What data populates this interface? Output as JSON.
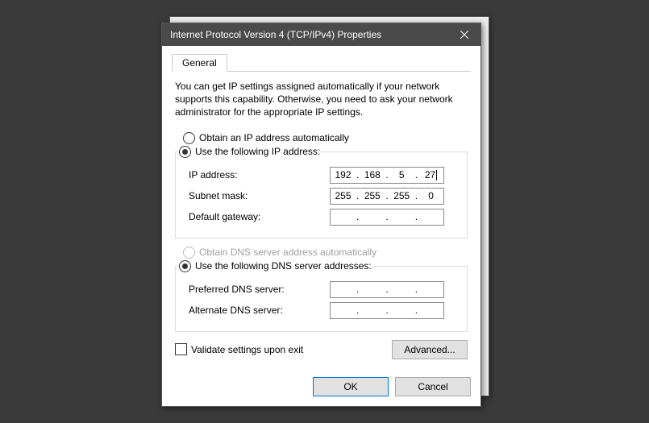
{
  "window": {
    "title": "Internet Protocol Version 4 (TCP/IPv4) Properties"
  },
  "tabs": {
    "general": "General"
  },
  "description": "You can get IP settings assigned automatically if your network supports this capability. Otherwise, you need to ask your network administrator for the appropriate IP settings.",
  "ip": {
    "auto_label": "Obtain an IP address automatically",
    "manual_label": "Use the following IP address:",
    "ip_label": "IP address:",
    "ip_o1": "192",
    "ip_o2": "168",
    "ip_o3": "5",
    "ip_o4": "27",
    "mask_label": "Subnet mask:",
    "mask_o1": "255",
    "mask_o2": "255",
    "mask_o3": "255",
    "mask_o4": "0",
    "gw_label": "Default gateway:",
    "gw_o1": "",
    "gw_o2": "",
    "gw_o3": "",
    "gw_o4": ""
  },
  "dns": {
    "auto_label": "Obtain DNS server address automatically",
    "manual_label": "Use the following DNS server addresses:",
    "pref_label": "Preferred DNS server:",
    "pref_o1": "",
    "pref_o2": "",
    "pref_o3": "",
    "pref_o4": "",
    "alt_label": "Alternate DNS server:",
    "alt_o1": "",
    "alt_o2": "",
    "alt_o3": "",
    "alt_o4": ""
  },
  "validate_label": "Validate settings upon exit",
  "buttons": {
    "advanced": "Advanced...",
    "ok": "OK",
    "cancel": "Cancel"
  }
}
